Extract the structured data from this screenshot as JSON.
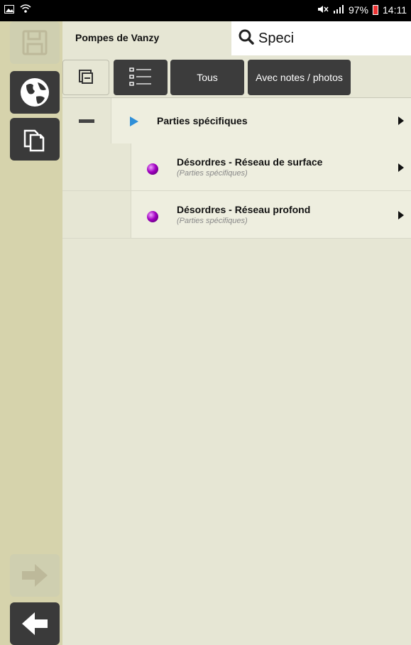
{
  "status_bar": {
    "battery": "97%",
    "time": "14:11"
  },
  "header": {
    "project_title": "Pompes de Vanzy",
    "search_value": "Speci"
  },
  "toolbar": {
    "filter_all": "Tous",
    "filter_notes_photos": "Avec notes / photos"
  },
  "list": {
    "group": {
      "label": "Parties spécifiques"
    },
    "items": [
      {
        "title": "Désordres - Réseau de surface",
        "subtitle": "(Parties spécifiques)"
      },
      {
        "title": "Désordres - Réseau profond",
        "subtitle": "(Parties spécifiques)"
      }
    ]
  },
  "icons": {
    "sidebar": [
      "save-icon",
      "globe-icon",
      "copy-icon",
      "arrow-right-icon",
      "arrow-left-icon"
    ],
    "toolbar": [
      "collapse-icon",
      "list-icon"
    ],
    "list": [
      "expand-triangle-icon",
      "sphere-icon",
      "chevron-right-icon"
    ]
  },
  "colors": {
    "sidebar_bg": "#d6d3ac",
    "main_bg": "#e6e6d4",
    "dark_button": "#3a3a3a",
    "expand_triangle": "#2f8fd8",
    "sphere": "#a000c0"
  }
}
